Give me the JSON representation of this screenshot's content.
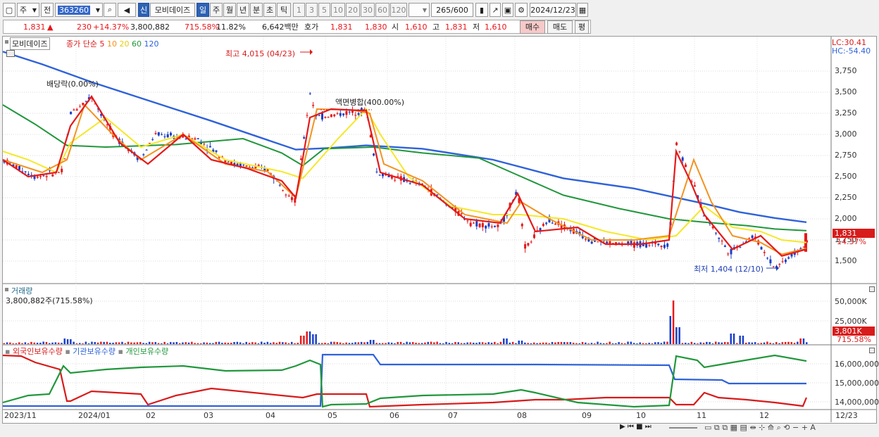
{
  "toolbar": {
    "period_select": "주",
    "prev_label": "전",
    "code": "363260",
    "stock_name": "모비데이즈",
    "new_badge": "신",
    "periods": [
      "일",
      "주",
      "월",
      "년",
      "분",
      "초",
      "틱"
    ],
    "active_period": "일",
    "intervals": [
      "1",
      "3",
      "5",
      "10",
      "20",
      "30",
      "60",
      "120"
    ],
    "count": "265",
    "count_total": "/600",
    "date": "2024/12/23"
  },
  "quote": {
    "price": "1,831",
    "change_arrow": "▲",
    "change": "230",
    "change_pct": "+14.37%",
    "volume": "3,800,882",
    "volume_pct": "715.58%",
    "turnover_pct": "11.82%",
    "amount": "6,642백만",
    "hoga_label": "호가",
    "ask": "1,831",
    "bid": "1,830",
    "open_label": "시",
    "open": "1,610",
    "high_label": "고",
    "high": "1,831",
    "low_label": "저",
    "low": "1,610",
    "buy_label": "매수",
    "sell_label": "매도",
    "eval_label": "평"
  },
  "price_panel": {
    "stock_label": "모비데이즈",
    "ma_title": "종가 단순",
    "ma_periods": [
      "5",
      "10",
      "20",
      "60",
      "120"
    ],
    "ma_colors": [
      "#e41a1a",
      "#f39220",
      "#f5e827",
      "#20973b",
      "#2f62d9"
    ],
    "lc": "LC:30.41",
    "hc": "HC:-54.40",
    "y_ticks": [
      "3,750",
      "3,500",
      "3,250",
      "3,000",
      "2,750",
      "2,500",
      "2,250",
      "2,000",
      "1,750",
      "1,500"
    ],
    "current_tag": "1,831",
    "current_pct": "14.37%",
    "annotations": {
      "high": "최고 4,015 (04/23)",
      "low": "최저 1,404 (12/10)",
      "dividend": "배당락(0.00%)",
      "split": "액면병합(400.00%)"
    }
  },
  "volume_panel": {
    "title": "거래량",
    "value": "3,800,882주(715.58%)",
    "y_ticks": [
      "50,000K",
      "25,000K"
    ],
    "current_tag": "3,801K",
    "current_pct": "715.58%"
  },
  "holding_panel": {
    "titles": [
      "외국인보유수량",
      "기관보유수량",
      "개인보유수량"
    ],
    "colors": [
      "#d81b1b",
      "#2f62d9",
      "#20973b"
    ],
    "y_ticks": [
      "16,000,000",
      "15,000,000",
      "14,000,000"
    ]
  },
  "x_axis": [
    "2023/11",
    "2024/01",
    "02",
    "03",
    "04",
    "05",
    "06",
    "07",
    "08",
    "09",
    "10",
    "11",
    "12",
    "12/23"
  ]
}
